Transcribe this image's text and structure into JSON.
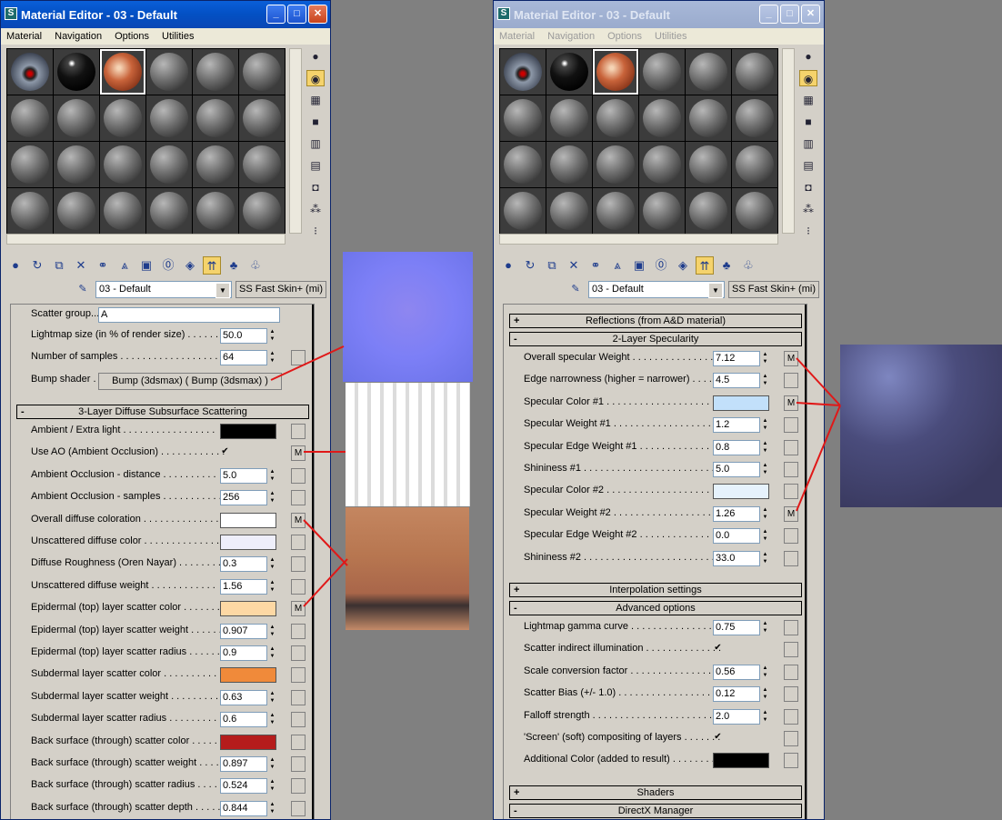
{
  "left_window": {
    "title": "Material Editor - 03 - Default",
    "menus": [
      "Material",
      "Navigation",
      "Options",
      "Utilities"
    ],
    "material_name": "03 - Default",
    "material_type": "SS Fast Skin+ (mi)",
    "scatter_group_label": "Scatter group...",
    "scatter_group_value": "A",
    "lightmap_label": "Lightmap size (in % of render size) . . . . . . .",
    "lightmap_value": "50.0",
    "samples_label": "Number of samples . . . . . . . . . . . . . . . . . .",
    "samples_value": "64",
    "bump_label": "Bump shader . .",
    "bump_value": "Bump (3dsmax)  ( Bump (3dsmax) )",
    "rollout_title": "3-Layer Diffuse Subsurface Scattering",
    "params": [
      {
        "label": "Ambient / Extra light . . . . . . . . . . . . . . . . .",
        "kind": "swatch",
        "color": "#000000",
        "m": ""
      },
      {
        "label": "Use AO (Ambient Occlusion) . . . . . . . . . . . .",
        "kind": "check",
        "value": "✔",
        "m": "M"
      },
      {
        "label": "Ambient Occlusion - distance . . . . . . . . . .",
        "kind": "spin",
        "value": "5.0",
        "m": ""
      },
      {
        "label": "Ambient Occlusion - samples . . . . . . . . . . .",
        "kind": "spin",
        "value": "256",
        "m": ""
      },
      {
        "label": "Overall diffuse coloration . . . . . . . . . . . . . .",
        "kind": "swatch",
        "color": "#ffffff",
        "m": "M"
      },
      {
        "label": "Unscattered diffuse color . . . . . . . . . . . . . .",
        "kind": "swatch",
        "color": "#eeeefa",
        "m": ""
      },
      {
        "label": "Diffuse Roughness (Oren Nayar) . . . . . . . .",
        "kind": "spin",
        "value": "0.3",
        "m": ""
      },
      {
        "label": "Unscattered diffuse weight . . . . . . . . . . . .",
        "kind": "spin",
        "value": "1.56",
        "m": ""
      },
      {
        "label": "Epidermal (top) layer scatter color . . . . . . . .",
        "kind": "swatch",
        "color": "#fdd8a4",
        "m": "M"
      },
      {
        "label": "Epidermal (top) layer scatter weight . . . . . .",
        "kind": "spin",
        "value": "0.907",
        "m": ""
      },
      {
        "label": "Epidermal (top) layer scatter radius . . . . . .",
        "kind": "spin",
        "value": "0.9",
        "m": ""
      },
      {
        "label": "Subdermal layer scatter color . . . . . . . . . . .",
        "kind": "swatch",
        "color": "#f08a3a",
        "m": ""
      },
      {
        "label": "Subdermal layer scatter weight . . . . . . . . . .",
        "kind": "spin",
        "value": "0.63",
        "m": ""
      },
      {
        "label": "Subdermal layer scatter radius . . . . . . . . . .",
        "kind": "spin",
        "value": "0.6",
        "m": ""
      },
      {
        "label": "Back surface (through) scatter color . . . . . .",
        "kind": "swatch",
        "color": "#b51c1c",
        "m": ""
      },
      {
        "label": "Back surface (through) scatter weight . . . . .",
        "kind": "spin",
        "value": "0.897",
        "m": ""
      },
      {
        "label": "Back surface (through) scatter radius . . . . .",
        "kind": "spin",
        "value": "0.524",
        "m": ""
      },
      {
        "label": "Back surface (through) scatter depth . . . . .",
        "kind": "spin",
        "value": "0.844",
        "m": ""
      }
    ]
  },
  "right_window": {
    "title": "Material Editor - 03 - Default",
    "menus": [
      "Material",
      "Navigation",
      "Options",
      "Utilities"
    ],
    "material_name": "03 - Default",
    "material_type": "SS Fast Skin+ (mi)",
    "rollout_reflections": "Reflections (from A&D material)",
    "rollout_specularity": "2-Layer Specularity",
    "spec_params": [
      {
        "label": "Overall specular Weight . . . . . . . . . . . . . . .",
        "kind": "spin",
        "value": "7.12",
        "m": "M"
      },
      {
        "label": "Edge narrowness (higher = narrower) . . . . . .",
        "kind": "spin",
        "value": "4.5",
        "m": ""
      },
      {
        "label": "Specular Color #1 . . . . . . . . . . . . . . . . . . . .",
        "kind": "swatch",
        "color": "#c2e0fa",
        "m": "M"
      },
      {
        "label": "Specular Weight #1 . . . . . . . . . . . . . . . . . . .",
        "kind": "spin",
        "value": "1.2",
        "m": ""
      },
      {
        "label": "Specular Edge Weight #1 . . . . . . . . . . . . . .",
        "kind": "spin",
        "value": "0.8",
        "m": ""
      },
      {
        "label": "Shininess #1 . . . . . . . . . . . . . . . . . . . . . . . .",
        "kind": "spin",
        "value": "5.0",
        "m": ""
      },
      {
        "label": "Specular Color #2 . . . . . . . . . . . . . . . . . . . .",
        "kind": "swatch",
        "color": "#e6f2fc",
        "m": ""
      },
      {
        "label": "Specular Weight #2 . . . . . . . . . . . . . . . . . . .",
        "kind": "spin",
        "value": "1.26",
        "m": "M"
      },
      {
        "label": "Specular Edge Weight #2 . . . . . . . . . . . . . .",
        "kind": "spin",
        "value": "0.0",
        "m": ""
      },
      {
        "label": "Shininess #2 . . . . . . . . . . . . . . . . . . . . . . . .",
        "kind": "spin",
        "value": "33.0",
        "m": ""
      }
    ],
    "rollout_interpolation": "Interpolation settings",
    "rollout_advanced": "Advanced options",
    "adv_params": [
      {
        "label": "Lightmap gamma curve . . . . . . . . . . . . . . . . .",
        "kind": "spin",
        "value": "0.75",
        "m": ""
      },
      {
        "label": "Scatter indirect illumination . . . . . . . . . . . . . .",
        "kind": "check",
        "value": "✔",
        "m": ""
      },
      {
        "label": "Scale conversion factor . . . . . . . . . . . . . . . .",
        "kind": "spin",
        "value": "0.56",
        "m": ""
      },
      {
        "label": "Scatter Bias (+/- 1.0) . . . . . . . . . . . . . . . . . .",
        "kind": "spin",
        "value": "0.12",
        "m": ""
      },
      {
        "label": "Falloff strength . . . . . . . . . . . . . . . . . . . . . .",
        "kind": "spin",
        "value": "2.0",
        "m": ""
      },
      {
        "label": "'Screen' (soft) compositing of layers . . . . . . .",
        "kind": "check",
        "value": "✔",
        "m": ""
      },
      {
        "label": "Additional Color (added to result) . . . . . . . . . .",
        "kind": "swatch",
        "color": "#000000",
        "m": ""
      }
    ],
    "rollout_shaders": "Shaders",
    "rollout_directx": "DirectX Manager"
  },
  "window_buttons": {
    "minimize": "_",
    "maximize": "□",
    "close": "✕"
  },
  "colors": {
    "titlebar_active": "#0350c4",
    "titlebar_inactive": "#9aabcd",
    "panel_bg": "#d4d0c8",
    "link_line": "#e01818"
  }
}
